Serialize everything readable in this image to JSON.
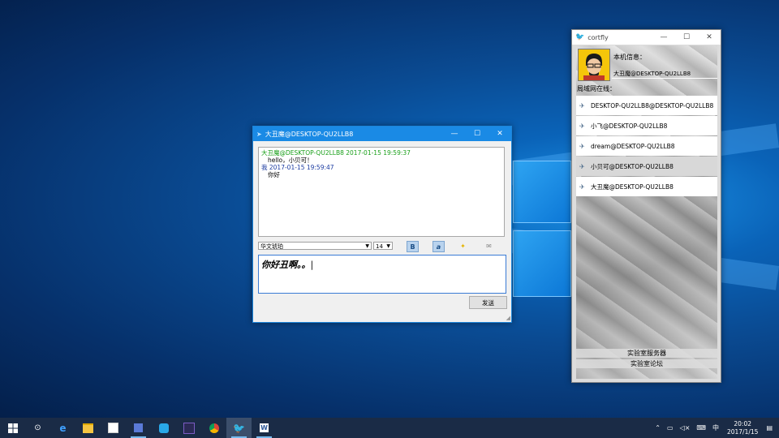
{
  "desktop": {
    "name": "Windows 10 desktop"
  },
  "chat_window": {
    "title": "大丑魔@DESKTOP-QU2LLB8",
    "minimize": "—",
    "maximize": "☐",
    "close": "✕",
    "messages": [
      {
        "header": "大丑魔@DESKTOP-QU2LLB8 2017-01-15 19:59:37",
        "body": "hello，小贝可！",
        "color": "#1aa01a"
      },
      {
        "header": "我 2017-01-15 19:59:47",
        "body": "你好",
        "color": "#1a3aa0"
      }
    ],
    "font_name": "华文琥珀",
    "font_size": "14",
    "compose_text": "你好丑啊。。",
    "send_label": "发送",
    "tools": {
      "bold": "B",
      "italic": "a",
      "color": "✦",
      "history": "✉"
    }
  },
  "cortfly": {
    "title": "cortfly",
    "minimize": "—",
    "maximize": "☐",
    "close": "✕",
    "local_info_label": "本机信息：",
    "local_user": "大丑魔@DESKTOP-QU2LLB8",
    "online_label": "局域网在线：",
    "peers": [
      {
        "name": "DESKTOP-QU2LLB8@DESKTOP-QU2LLB8",
        "selected": false
      },
      {
        "name": "小飞@DESKTOP-QU2LLB8",
        "selected": false
      },
      {
        "name": "dream@DESKTOP-QU2LLB8",
        "selected": false
      },
      {
        "name": "小贝可@DESKTOP-QU2LLB8",
        "selected": true
      },
      {
        "name": "大丑魔@DESKTOP-QU2LLB8",
        "selected": false
      }
    ],
    "lab_server_label": "实验室服务器",
    "lab_forum_label": "实验室论坛"
  },
  "taskbar": {
    "start_icon": "windows-logo",
    "items": [
      "cortana-icon",
      "edge-icon",
      "file-explorer-icon",
      "store-icon",
      "app-icon",
      "qq-icon",
      "visual-studio-icon",
      "chrome-icon",
      "cortfly-icon",
      "word-icon"
    ],
    "ime": "中",
    "time": "20:02",
    "date": "2017/1/15"
  }
}
